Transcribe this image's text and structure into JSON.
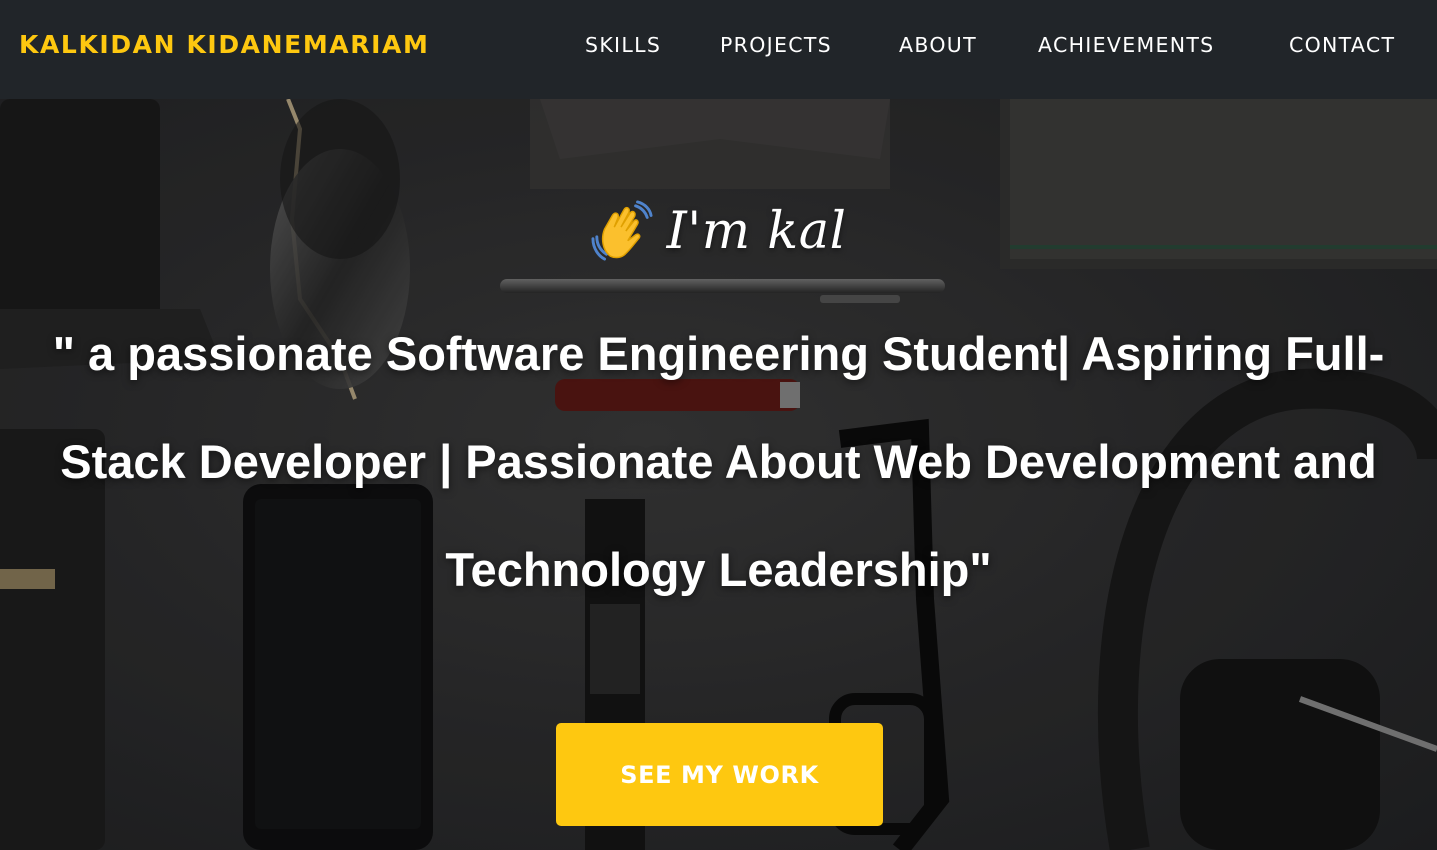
{
  "navbar": {
    "brand": "KALKIDAN KIDANEMARIAM",
    "items": [
      {
        "label": "SKILLS"
      },
      {
        "label": "PROJECTS"
      },
      {
        "label": "ABOUT"
      },
      {
        "label": "ACHIEVEMENTS"
      },
      {
        "label": "CONTACT"
      }
    ]
  },
  "hero": {
    "greeting_icon": "waving-hand-icon",
    "greeting": "I'm kal",
    "tagline": "\" a passionate Software Engineering Student| Aspiring Full-Stack Developer | Passionate About Web Development and Technology Leadership\"",
    "cta_label": "SEE MY WORK"
  },
  "colors": {
    "navbar_bg": "#212529",
    "accent": "#fec810",
    "text": "#ffffff"
  }
}
